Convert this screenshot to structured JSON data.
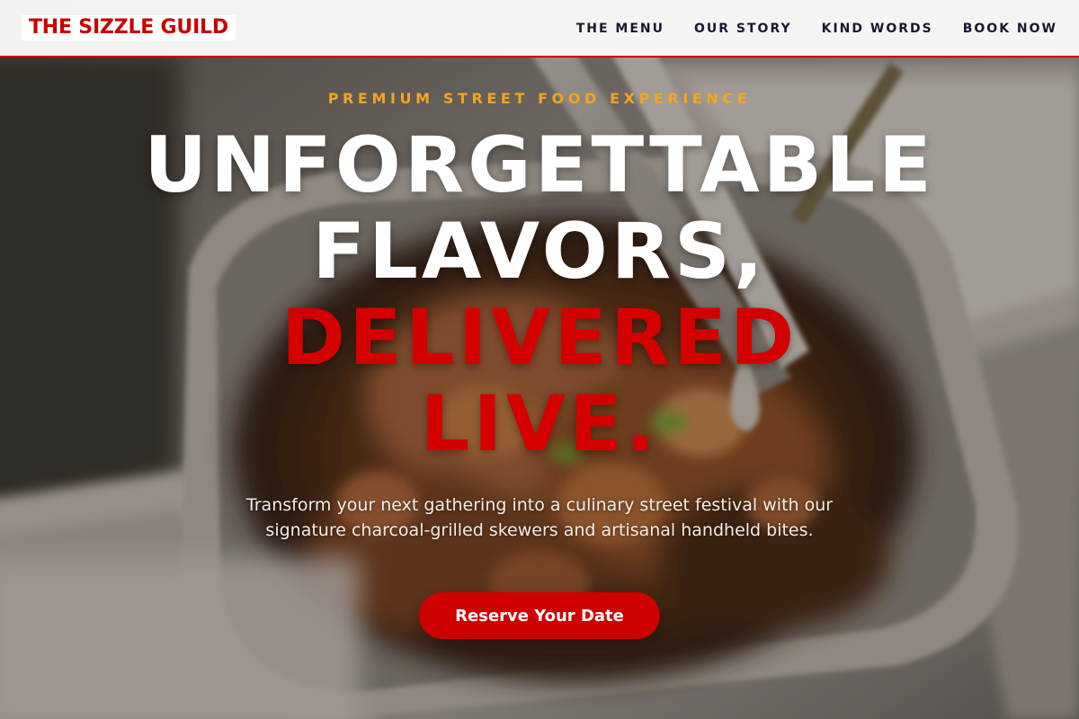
{
  "nav": {
    "logo": "THE SIZZLE GUILD",
    "links": [
      "THE MENU",
      "OUR STORY",
      "KIND WORDS",
      "BOOK NOW"
    ]
  },
  "hero": {
    "eyebrow": "PREMIUM STREET FOOD EXPERIENCE",
    "headline_lines": [
      "UNFORGETTABLE",
      "FLAVORS,",
      "DELIVERED",
      "LIVE."
    ],
    "subtext": "Transform your next gathering into a culinary street festival with our signature charcoal-grilled skewers and artisanal handheld bites.",
    "cta_label": "Reserve Your Date",
    "background_image": "grilled-food-tray-photo"
  },
  "colors": {
    "brand_red": "#cf0000",
    "eyebrow_gold": "#f4a51c",
    "nav_text": "#161a2e",
    "nav_background": "#fafaf9"
  }
}
